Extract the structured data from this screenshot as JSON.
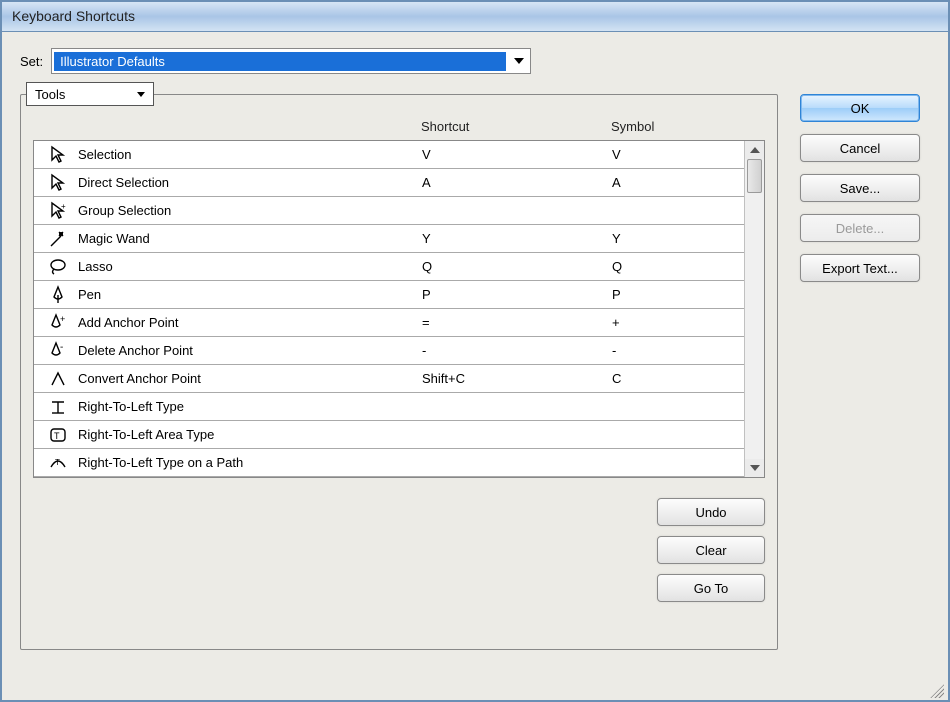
{
  "window": {
    "title": "Keyboard Shortcuts"
  },
  "set": {
    "label": "Set:",
    "selected": "Illustrator Defaults"
  },
  "category": {
    "selected": "Tools"
  },
  "columns": {
    "name": "",
    "shortcut": "Shortcut",
    "symbol": "Symbol"
  },
  "rows": [
    {
      "icon": "selection",
      "name": "Selection",
      "shortcut": "V",
      "symbol": "V"
    },
    {
      "icon": "direct",
      "name": "Direct Selection",
      "shortcut": "A",
      "symbol": "A"
    },
    {
      "icon": "group",
      "name": "Group Selection",
      "shortcut": "",
      "symbol": ""
    },
    {
      "icon": "wand",
      "name": "Magic Wand",
      "shortcut": "Y",
      "symbol": "Y"
    },
    {
      "icon": "lasso",
      "name": "Lasso",
      "shortcut": "Q",
      "symbol": "Q"
    },
    {
      "icon": "pen",
      "name": "Pen",
      "shortcut": "P",
      "symbol": "P"
    },
    {
      "icon": "pen-plus",
      "name": "Add Anchor Point",
      "shortcut": "=",
      "symbol": "+"
    },
    {
      "icon": "pen-minus",
      "name": "Delete Anchor Point",
      "shortcut": "-",
      "symbol": "-"
    },
    {
      "icon": "convert",
      "name": "Convert Anchor Point",
      "shortcut": "Shift+C",
      "symbol": "C"
    },
    {
      "icon": "rtl-type",
      "name": "Right-To-Left Type",
      "shortcut": "",
      "symbol": ""
    },
    {
      "icon": "rtl-area",
      "name": "Right-To-Left Area Type",
      "shortcut": "",
      "symbol": ""
    },
    {
      "icon": "rtl-path",
      "name": "Right-To-Left Type on a Path",
      "shortcut": "",
      "symbol": ""
    }
  ],
  "innerButtons": {
    "undo": "Undo",
    "clear": "Clear",
    "goto": "Go To"
  },
  "sideButtons": {
    "ok": "OK",
    "cancel": "Cancel",
    "save": "Save...",
    "delete": "Delete...",
    "export": "Export Text..."
  }
}
